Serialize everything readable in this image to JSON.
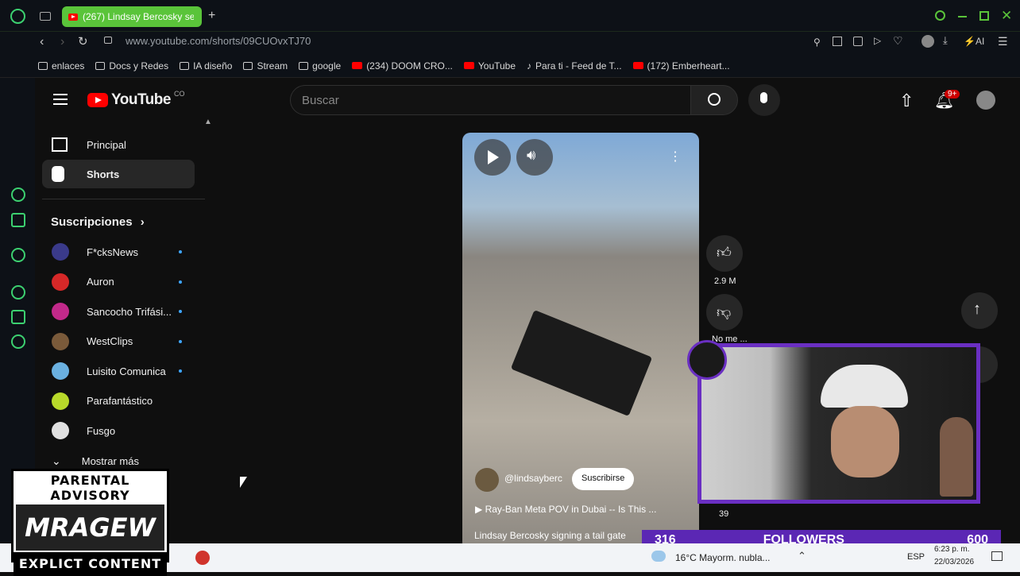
{
  "browser": {
    "tab_title": "(267) Lindsay Bercosky se",
    "url": "www.youtube.com/shorts/09CUOvxTJ70",
    "ai_label": "AI",
    "bookmarks": [
      "enlaces",
      "Docs y Redes",
      "IA diseño",
      "Stream",
      "google",
      "(234) DOOM CRO...",
      "YouTube",
      "Para ti - Feed de T...",
      "(172) Emberheart..."
    ]
  },
  "youtube": {
    "logo_text": "YouTube",
    "logo_country": "CO",
    "search_placeholder": "Buscar",
    "notification_badge": "9+",
    "sidebar": {
      "items": [
        {
          "label": "Principal"
        },
        {
          "label": "Shorts"
        }
      ],
      "subscriptions_title": "Suscripciones",
      "subscriptions": [
        {
          "label": "F*cksNews",
          "color": "#3a3a8a",
          "new": true
        },
        {
          "label": "Auron",
          "color": "#d62828",
          "new": true
        },
        {
          "label": "Sancocho Trifási...",
          "color": "#c2298a",
          "new": true
        },
        {
          "label": "WestClips",
          "color": "#7a5a3a",
          "new": true
        },
        {
          "label": "Luisito Comunica",
          "color": "#6ab0e0",
          "new": true
        },
        {
          "label": "Parafantástico",
          "color": "#b8d92a",
          "new": false
        },
        {
          "label": "Fusgo",
          "color": "#e0e0e0",
          "new": false
        }
      ],
      "more_label": "Mostrar más"
    },
    "short": {
      "channel": "@lindsayberc",
      "subscribe_label": "Suscribirse",
      "related_title": "Ray-Ban Meta POV in Dubai -- Is This ...",
      "caption": "Lindsay Bercosky signing a tail gate",
      "likes": "2.9 M",
      "dislike_label": "No me ...",
      "comments": "39"
    }
  },
  "overlay": {
    "followers_current": "316",
    "followers_label": "FOLLOWERS",
    "followers_goal": "600",
    "advisory_top": "PARENTAL ADVISORY",
    "advisory_logo": "MRAGEW",
    "advisory_bottom": "EXPLICT CONTENT"
  },
  "taskbar": {
    "weather": "16°C  Mayorm. nubla...",
    "lang": "ESP",
    "time": "6:23 p. m.",
    "date": "22/03/2026"
  }
}
